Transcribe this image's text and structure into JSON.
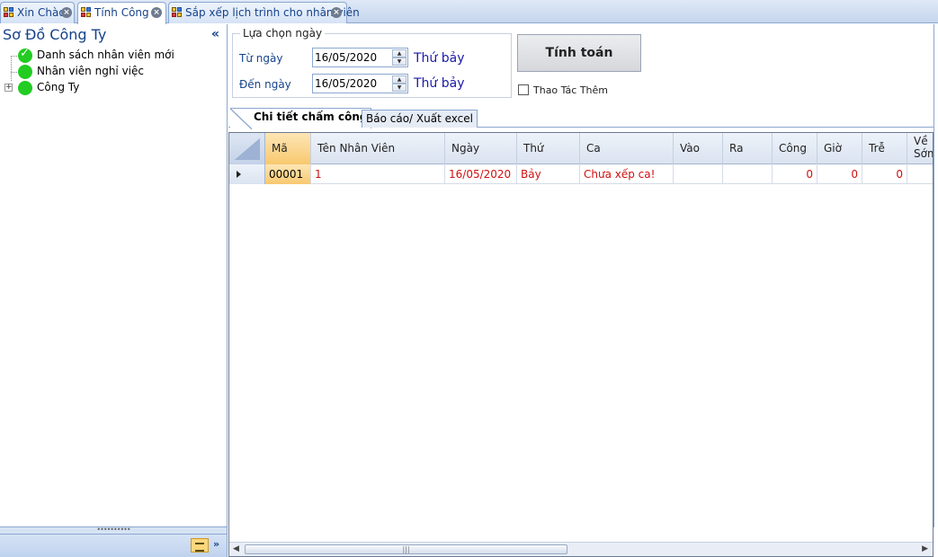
{
  "tabs": [
    {
      "label": "Xin Chào"
    },
    {
      "label": "Tính Công"
    },
    {
      "label": "Sắp xếp lịch trình cho nhân viên"
    }
  ],
  "sidebar": {
    "title": "Sơ Đồ Công Ty",
    "collapse_icon": "«",
    "items": [
      {
        "label": "Danh sách nhân viên mới",
        "status": "checked"
      },
      {
        "label": "Nhân viên nghỉ việc",
        "status": "active"
      },
      {
        "label": "Công Ty",
        "status": "active",
        "expander": "+"
      }
    ],
    "footer_more": "»"
  },
  "date_group": {
    "legend": "Lựa chọn ngày",
    "from_label": "Từ ngày",
    "from_value": "16/05/2020",
    "from_weekday": "Thứ bảy",
    "to_label": "Đến ngày",
    "to_value": "16/05/2020",
    "to_weekday": "Thứ bảy"
  },
  "calc_button": "Tính toán",
  "extra_checkbox": {
    "label": "Thao Tác Thêm",
    "checked": false
  },
  "inner_tabs": [
    {
      "label": "Chi tiết chấm công"
    },
    {
      "label": "Báo cáo/ Xuất excel"
    }
  ],
  "grid": {
    "columns": [
      "Mã",
      "Tên Nhân Viên",
      "Ngày",
      "Thứ",
      "Ca",
      "Vào",
      "Ra",
      "Công",
      "Giờ",
      "Trễ",
      "Về Sớm"
    ],
    "rows": [
      [
        "00001",
        "1",
        "16/05/2020",
        "Bảy",
        "Chưa xếp ca!",
        "",
        "",
        "0",
        "0",
        "0",
        ""
      ]
    ]
  },
  "scroll_left": "◀",
  "scroll_right": "▶",
  "scroll_grip": "|||",
  "colors": {
    "accent": "#15428b",
    "weekday": "#1a1aaa",
    "row_text": "#d01010",
    "selected": "#f8c86f"
  }
}
